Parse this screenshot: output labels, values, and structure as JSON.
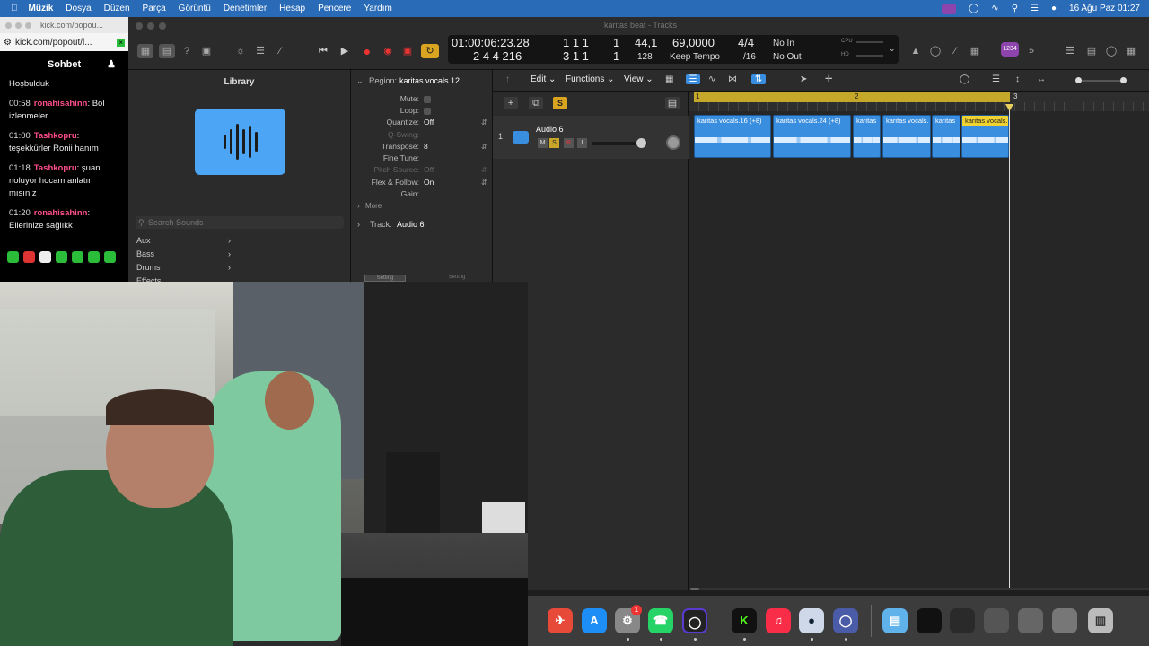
{
  "menubar": {
    "apple": "",
    "app": "Müzik",
    "items": [
      "Dosya",
      "Düzen",
      "Parça",
      "Görüntü",
      "Denetimler",
      "Hesap",
      "Pencere",
      "Yardım"
    ],
    "datetime": "16 Ağu Paz  01:27"
  },
  "browser": {
    "tab_title": "kick.com/popou...",
    "url": "kick.com/popout/l...",
    "chat_title": "Sohbet",
    "messages": [
      {
        "time": "",
        "user": "",
        "text": "Hoşbulduk"
      },
      {
        "time": "00:58",
        "user": "ronahisahinn",
        "text": "Bol izlenmeler"
      },
      {
        "time": "01:00",
        "user": "Tashkopru",
        "text": "teşekkürler Ronii hanım"
      },
      {
        "time": "01:18",
        "user": "Tashkopru",
        "text": "şuan noluyor hocam anlatır mısınız"
      },
      {
        "time": "01:20",
        "user": "ronahisahinn",
        "text": "Ellerinize sağlıkk"
      }
    ]
  },
  "window_title": "karitas beat - Tracks",
  "lcd": {
    "time": "01:00:06:23.28",
    "bars_top": "1  1  1",
    "bars_top_last": "1",
    "bars_bottom": "2  4  4  216",
    "bars_bottom2": "3  1  1",
    "bars_bottom_last": "1",
    "tempo_sample": "44,1",
    "tempo_sample_sub": "128",
    "tempo": "69,0000",
    "tempo_sub": "Keep Tempo",
    "signature": "4/4",
    "division": "/16",
    "in": "No In",
    "out": "No Out",
    "cpu": "CPU",
    "hd": "HD"
  },
  "user_badge": "1234",
  "library": {
    "title": "Library",
    "search_placeholder": "Search Sounds",
    "categories": [
      "Aux",
      "Bass",
      "Drums",
      "Effects"
    ]
  },
  "inspector": {
    "region_label": "Region:",
    "region_name": "karitas vocals.12",
    "rows": [
      {
        "label": "Mute:",
        "value": ""
      },
      {
        "label": "Loop:",
        "value": ""
      },
      {
        "label": "Quantize:",
        "value": "Off"
      },
      {
        "label": "Q-Swing:",
        "value": ""
      },
      {
        "label": "Transpose:",
        "value": "8"
      },
      {
        "label": "Fine Tune:",
        "value": ""
      },
      {
        "label": "Pitch Source:",
        "value": "Off"
      },
      {
        "label": "Flex & Follow:",
        "value": "On"
      },
      {
        "label": "Gain:",
        "value": ""
      }
    ],
    "more": "More",
    "track_label": "Track:",
    "track_name": "Audio 6",
    "setting1": "Setting",
    "setting2": "Setting"
  },
  "tracks_header": {
    "edit": "Edit",
    "functions": "Functions",
    "view": "View"
  },
  "track": {
    "number": "1",
    "name": "Audio 6",
    "m": "M",
    "s": "S",
    "r": "R",
    "i": "I",
    "global_s": "S"
  },
  "ruler": {
    "bar1": "1",
    "bar2": "2",
    "bar3": "3"
  },
  "regions": [
    {
      "name": "karitas vocals.16 (+8)"
    },
    {
      "name": "karitas vocals.24 (+8)"
    },
    {
      "name": "karitas"
    },
    {
      "name": "karitas vocals."
    },
    {
      "name": "karitas"
    },
    {
      "name": "karitas vocals."
    }
  ],
  "dock": {
    "badge": "1",
    "kick": "K"
  },
  "colors": {
    "menubar": "#2a6bb8",
    "region": "#3a8ee0",
    "ruler": "#c5a72a",
    "chat_user": "#ff4f8b",
    "library_icon": "#4da6f5"
  }
}
